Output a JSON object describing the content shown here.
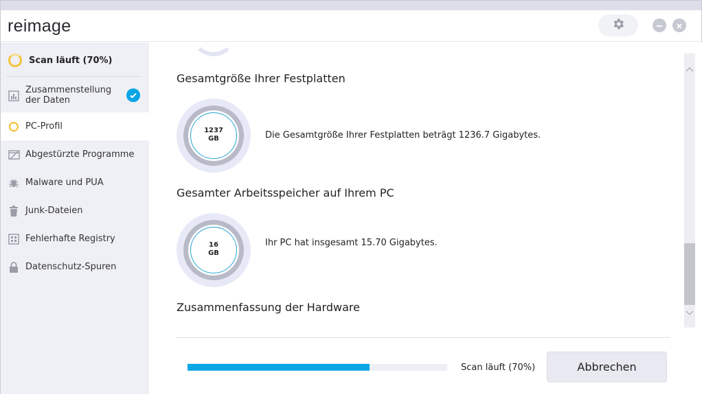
{
  "app": {
    "logo": "reimage"
  },
  "header": {
    "settings_icon": "gear-icon",
    "minimize_icon": "minimize-icon",
    "close_icon": "close-icon"
  },
  "sidebar": {
    "scan_status": "Scan läuft (70%)",
    "items": [
      {
        "label": "Zusammenstellung der Daten",
        "icon": "chart-icon",
        "state": "done"
      },
      {
        "label": "PC-Profil",
        "icon": "progress-ring-icon",
        "state": "active"
      },
      {
        "label": "Abgestürzte Programme",
        "icon": "crashed-window-icon",
        "state": "pending"
      },
      {
        "label": "Malware und PUA",
        "icon": "bug-icon",
        "state": "pending"
      },
      {
        "label": "Junk-Dateien",
        "icon": "trash-icon",
        "state": "pending"
      },
      {
        "label": "Fehlerhafte Registry",
        "icon": "registry-icon",
        "state": "pending"
      },
      {
        "label": "Datenschutz-Spuren",
        "icon": "lock-icon",
        "state": "pending"
      }
    ]
  },
  "main": {
    "sections": [
      {
        "title": "Gesamtgröße Ihrer Festplatten",
        "value": "1237",
        "unit": "GB",
        "description": "Die Gesamtgröße Ihrer Festplatten beträgt 1236.7 Gigabytes."
      },
      {
        "title": "Gesamter Arbeitsspeicher auf Ihrem PC",
        "value": "16",
        "unit": "GB",
        "description": "Ihr PC hat insgesamt 15.70 Gigabytes."
      },
      {
        "title": "Zusammenfassung der Hardware"
      }
    ]
  },
  "footer": {
    "progress_percent": 70,
    "progress_label": "Scan läuft (70%)",
    "cancel_label": "Abbrechen"
  },
  "colors": {
    "accent": "#0aa6e6",
    "scan_ring": "#f4c33e",
    "sidebar_bg": "#eff0f5"
  }
}
